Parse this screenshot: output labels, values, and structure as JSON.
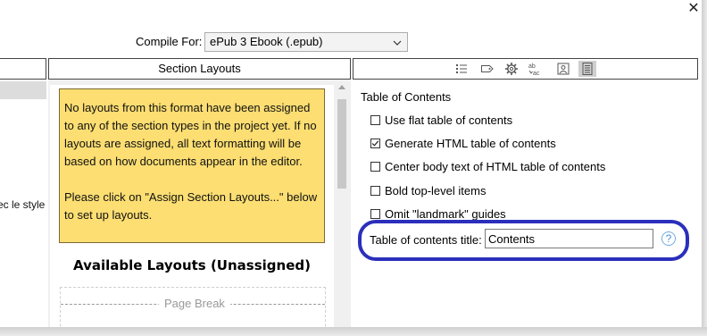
{
  "window": {
    "close_glyph": "✕"
  },
  "compile": {
    "label": "Compile For:",
    "selected": "ePub 3 Ebook (.epub)"
  },
  "left_panel": {
    "clipped_text": "ec le style"
  },
  "section_layouts": {
    "header": "Section Layouts",
    "note_paragraph_1": "No layouts from this format have been assigned to any of the section types in the project yet. If no layouts are assigned, all text formatting will be based on how documents appear in the editor.",
    "note_paragraph_2": "Please click on \"Assign Section Layouts...\" below to set up layouts.",
    "available_heading": "Available Layouts (Unassigned)",
    "page_break_label": "Page Break"
  },
  "toolbar_icons": [
    "list-icon",
    "label-tag-icon",
    "gear-icon",
    "text-replace-icon",
    "image-icon",
    "document-icon"
  ],
  "toc": {
    "heading": "Table of Contents",
    "options": [
      {
        "label": "Use flat table of contents",
        "checked": false
      },
      {
        "label": "Generate HTML table of contents",
        "checked": true
      },
      {
        "label": "Center body text of HTML table of contents",
        "checked": false
      },
      {
        "label": "Bold top-level items",
        "checked": false
      },
      {
        "label": "Omit \"landmark\" guides",
        "checked": false
      }
    ],
    "title_label": "Table of contents title:",
    "title_value": "Contents",
    "help_glyph": "?"
  },
  "colors": {
    "highlight_ring": "#2b2fbb",
    "note_background": "#fcde72",
    "help_icon": "#4a90d9"
  }
}
